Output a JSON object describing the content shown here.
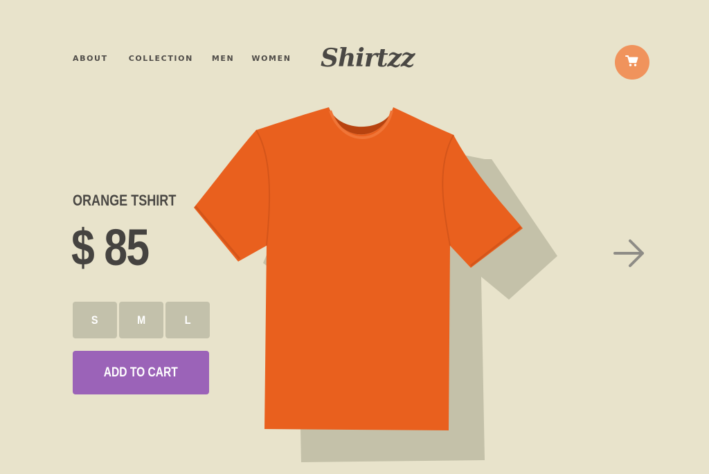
{
  "nav": {
    "items": [
      {
        "label": "ABOUT"
      },
      {
        "label": "COLLECTION"
      },
      {
        "label": "MEN"
      },
      {
        "label": "WOMEN"
      }
    ]
  },
  "brand": {
    "logo_text": "Shirtzz"
  },
  "header": {
    "cart_icon": "shopping-cart-icon"
  },
  "product": {
    "name": "ORANGE TSHIRT",
    "price": "$ 85",
    "sizes": [
      "S",
      "M",
      "L"
    ],
    "add_to_cart_label": "ADD TO CART",
    "image_icon": "orange-tshirt-image"
  },
  "navigation": {
    "next_icon": "arrow-right-icon"
  },
  "colors": {
    "background": "#e8e3cb",
    "accent_cart": "#f0935c",
    "button_primary": "#9b63b8",
    "size_button": "#c3c1ab",
    "shirt": "#e9601e",
    "shadow": "#c4c1a9"
  }
}
